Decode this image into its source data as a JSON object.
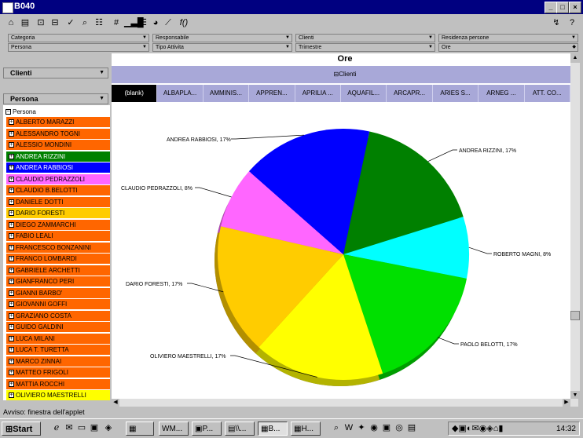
{
  "window": {
    "title": "B040"
  },
  "filters": {
    "row1": [
      {
        "label": "Categoria"
      },
      {
        "label": "Responsabile"
      },
      {
        "label": "Clienti"
      },
      {
        "label": "Residenza persone"
      }
    ],
    "row2": [
      {
        "label": "Persona"
      },
      {
        "label": "Tipo Attivita"
      },
      {
        "label": "Trimestre"
      },
      {
        "label": "Ore"
      }
    ]
  },
  "left": {
    "clienti_dropdown": "Clienti",
    "persona_dropdown": "Persona",
    "tree_root": "Persona",
    "persons": [
      {
        "name": "ALBERTO  MARAZZI",
        "color": "#ff6600"
      },
      {
        "name": "ALESSANDRO TOGNI",
        "color": "#ff6600"
      },
      {
        "name": "ALESSIO  MONDINI",
        "color": "#ff6600"
      },
      {
        "name": "ANDREA  RIZZINI",
        "color": "#008000"
      },
      {
        "name": "ANDREA RABBIOSI",
        "color": "#0000ff"
      },
      {
        "name": "CLAUDIO  PEDRAZZOLI",
        "color": "#ff66ff"
      },
      {
        "name": "CLAUDIO B.BELOTTI",
        "color": "#ff6600"
      },
      {
        "name": "DANIELE  DOTTI",
        "color": "#ff6600"
      },
      {
        "name": "DARIO  FORESTI",
        "color": "#ffcc00"
      },
      {
        "name": "DIEGO  ZAMMARCHI",
        "color": "#ff6600"
      },
      {
        "name": "FABIO  LEALI",
        "color": "#ff6600"
      },
      {
        "name": "FRANCESCO BONZANINI",
        "color": "#ff6600"
      },
      {
        "name": "FRANCO  LOMBARDI",
        "color": "#ff6600"
      },
      {
        "name": "GABRIELE  ARCHETTI",
        "color": "#ff6600"
      },
      {
        "name": "GIANFRANCO PERI",
        "color": "#ff6600"
      },
      {
        "name": "GIANNI  BARBO'",
        "color": "#ff6600"
      },
      {
        "name": "GIOVANNI  GOFFI",
        "color": "#ff6600"
      },
      {
        "name": "GRAZIANO  COSTA",
        "color": "#ff6600"
      },
      {
        "name": "GUIDO  GALDINI",
        "color": "#ff6600"
      },
      {
        "name": "LUCA  MILANI",
        "color": "#ff6600"
      },
      {
        "name": "LUCA T.  TURETTA",
        "color": "#ff6600"
      },
      {
        "name": "MARCO  ZINNAI",
        "color": "#ff6600"
      },
      {
        "name": "MATTEO  FRIGOLI",
        "color": "#ff6600"
      },
      {
        "name": "MATTIA  ROCCHI",
        "color": "#ff6600"
      },
      {
        "name": "OLIVIERO  MAESTRELLI",
        "color": "#ffff00"
      }
    ]
  },
  "main": {
    "header": "Ore",
    "band": "Clienti",
    "tabs": [
      "(blank)",
      "ALBAPLA...",
      "AMMINIS...",
      "APPREN...",
      "APRILIA ...",
      "AQUAFIL...",
      "ARCAPR...",
      "ARIES S...",
      "ARNEG ...",
      "ATT. CO..."
    ]
  },
  "chart_data": {
    "type": "pie",
    "slices": [
      {
        "label": "ANDREA  RIZZINI, 17%",
        "value": 17,
        "color": "#008000"
      },
      {
        "label": "ROBERTO  MAGNI, 8%",
        "value": 8,
        "color": "#00ffff"
      },
      {
        "label": "PAOLO  BELOTTI, 17%",
        "value": 17,
        "color": "#00e000"
      },
      {
        "label": "OLIVIERO  MAESTRELLI, 17%",
        "value": 17,
        "color": "#ffff00"
      },
      {
        "label": "DARIO  FORESTI, 17%",
        "value": 17,
        "color": "#ffcc00"
      },
      {
        "label": "CLAUDIO  PEDRAZZOLI, 8%",
        "value": 8,
        "color": "#ff66ff"
      },
      {
        "label": "ANDREA RABBIOSI, 17%",
        "value": 17,
        "color": "#0000ff"
      }
    ]
  },
  "status": {
    "text": "Avviso: finestra dell'applet"
  },
  "taskbar": {
    "start": "Start",
    "buttons": [
      "",
      "M...",
      "P...",
      "\\\\...",
      "B...",
      "H..."
    ],
    "clock": "14:32"
  }
}
